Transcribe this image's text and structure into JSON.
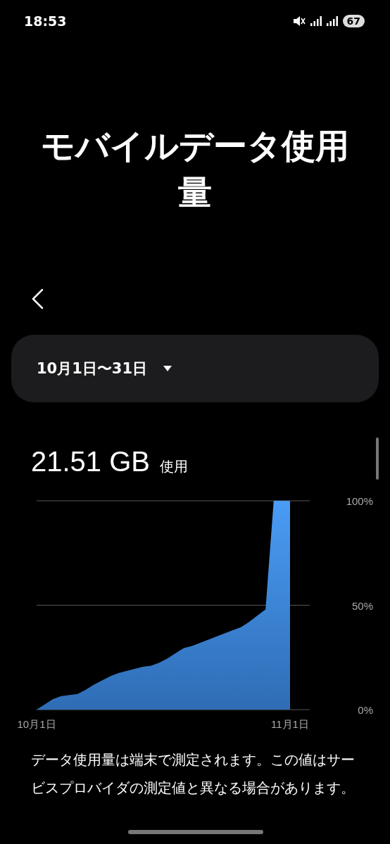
{
  "status_bar": {
    "time": "18:53",
    "battery": "67"
  },
  "title": "モバイルデータ使用量",
  "period": {
    "label": "10月1日〜31日"
  },
  "usage": {
    "amount": "21.51 GB",
    "unit_label": "使用"
  },
  "chart": {
    "chart_data": {
      "type": "area",
      "categories": [
        "10月1日",
        null,
        null,
        null,
        null,
        null,
        null,
        null,
        null,
        null,
        null,
        null,
        null,
        null,
        null,
        null,
        null,
        null,
        null,
        null,
        null,
        null,
        null,
        null,
        null,
        null,
        null,
        null,
        null,
        null,
        null,
        "11月1日"
      ],
      "series": [
        {
          "color": "#4a9cf5",
          "values": [
            0,
            2.5,
            5,
            6.5,
            7,
            7.5,
            9.5,
            12,
            14,
            16,
            17.5,
            18.5,
            19.5,
            20.5,
            21,
            22.5,
            24.5,
            27,
            29.5,
            30.5,
            32,
            33.5,
            35,
            36.5,
            38,
            39.5,
            42,
            45,
            48,
            100,
            100,
            100
          ]
        }
      ],
      "ylim": [
        0,
        100
      ],
      "yticks": [
        {
          "value": 0,
          "label": "0%"
        },
        {
          "value": 50,
          "label": "50%"
        },
        {
          "value": 100,
          "label": "100%"
        }
      ]
    }
  },
  "note": "データ使用量は端末で測定されます。この値はサービスプロバイダの測定値と異なる場合があります。"
}
